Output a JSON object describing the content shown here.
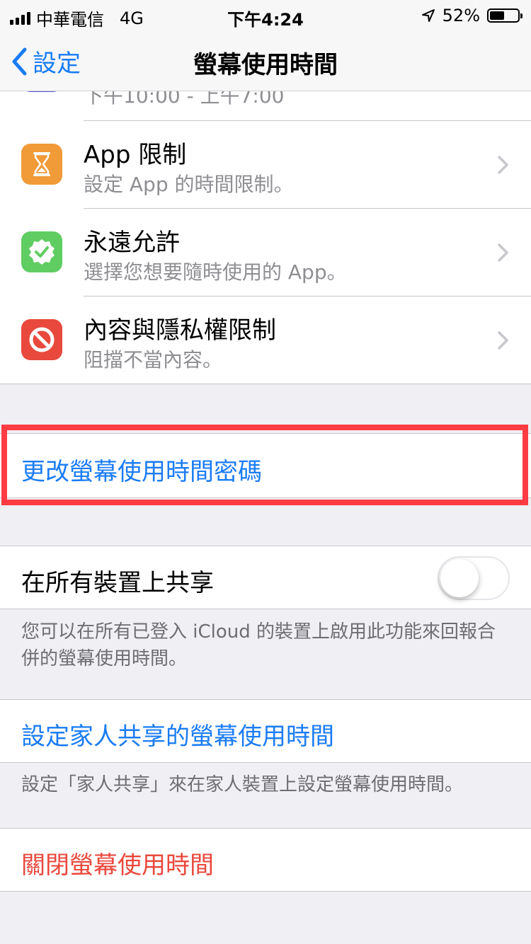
{
  "status_bar": {
    "carrier": "中華電信",
    "network": "4G",
    "time": "下午4:24",
    "battery": "52%",
    "battery_level": 0.52
  },
  "nav": {
    "back_label": "設定",
    "title": "螢幕使用時間"
  },
  "list": {
    "partial_subtitle": "下午10:00 - 上午7:00",
    "items": [
      {
        "title": "App 限制",
        "subtitle": "設定 App 的時間限制。",
        "icon": "hourglass-icon",
        "color": "#f19a38"
      },
      {
        "title": "永遠允許",
        "subtitle": "選擇您想要隨時使用的 App。",
        "icon": "checkmark-badge-icon",
        "color": "#5fcd61"
      },
      {
        "title": "內容與隱私權限制",
        "subtitle": "阻擋不當內容。",
        "icon": "prohibited-icon",
        "color": "#e9483c"
      }
    ]
  },
  "passcode": {
    "label": "更改螢幕使用時間密碼"
  },
  "share": {
    "label": "在所有裝置上共享",
    "on": false,
    "note": "您可以在所有已登入 iCloud 的裝置上啟用此功能來回報合併的螢幕使用時間。"
  },
  "family": {
    "label": "設定家人共享的螢幕使用時間",
    "note": "設定「家人共享」來在家人裝置上設定螢幕使用時間。"
  },
  "turn_off": {
    "label": "關閉螢幕使用時間"
  },
  "colors": {
    "link_blue": "#1a7cf5",
    "destructive_red": "#e9483c",
    "highlight_red": "#ff3b43"
  }
}
